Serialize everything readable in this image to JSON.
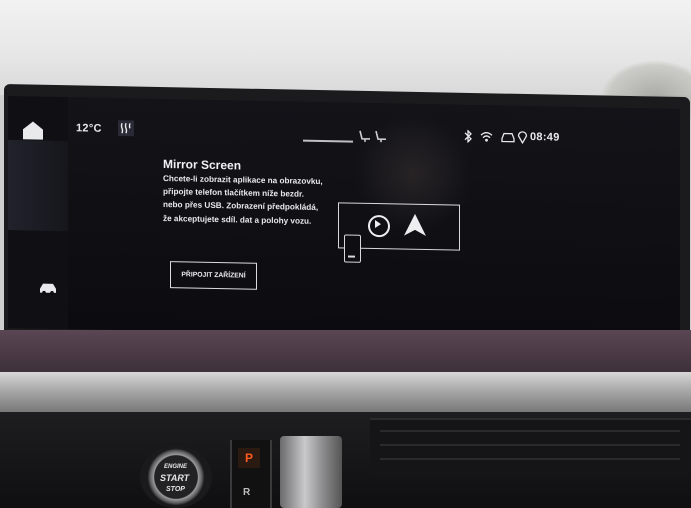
{
  "status_bar": {
    "temperature": "12°C",
    "time": "08:49"
  },
  "mirror_screen": {
    "title": "Mirror Screen",
    "description": "Chcete-li zobrazit aplikace na obrazovku, připojte telefon tlačítkem níže bezdr. nebo přes USB. Zobrazení předpokládá, že akceptujete sdíl. dat a polohy vozu.",
    "connect_button": "PŘIPOJIT ZAŘÍZENÍ"
  },
  "console": {
    "start_button_line1": "ENGINE",
    "start_button_line2": "START",
    "start_button_line3": "STOP",
    "gear_p": "P",
    "gear_r": "R"
  },
  "icons": {
    "home": "home-icon",
    "car": "car-icon",
    "seat_heat": "seat-heating-icon",
    "bluetooth": "bluetooth-icon",
    "wifi": "wifi-icon",
    "phone": "phone-icon",
    "carplay": "carplay-icon",
    "android_auto": "android-auto-icon"
  }
}
